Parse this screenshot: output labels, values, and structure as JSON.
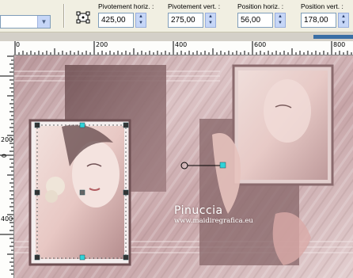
{
  "toolbar": {
    "mode_combo_value": "",
    "fields": [
      {
        "label": "Pivotement horiz. :",
        "value": "425,00"
      },
      {
        "label": "Pivotement vert. :",
        "value": "275,00"
      },
      {
        "label": "Position horiz. :",
        "value": "56,00"
      },
      {
        "label": "Position vert. :",
        "value": "178,00"
      }
    ]
  },
  "ruler": {
    "top_labels": [
      "0",
      "200",
      "400",
      "600",
      "800"
    ],
    "left_labels": [
      "0",
      "200",
      "400"
    ]
  },
  "watermark": {
    "name": "Pinuccia",
    "url": "www.maidiregrafica.eu"
  },
  "colors": {
    "canvas_bg": "#c9a9ad",
    "panel_dark": "#7a5a5c",
    "selection_handle": "#2fd3d8"
  }
}
